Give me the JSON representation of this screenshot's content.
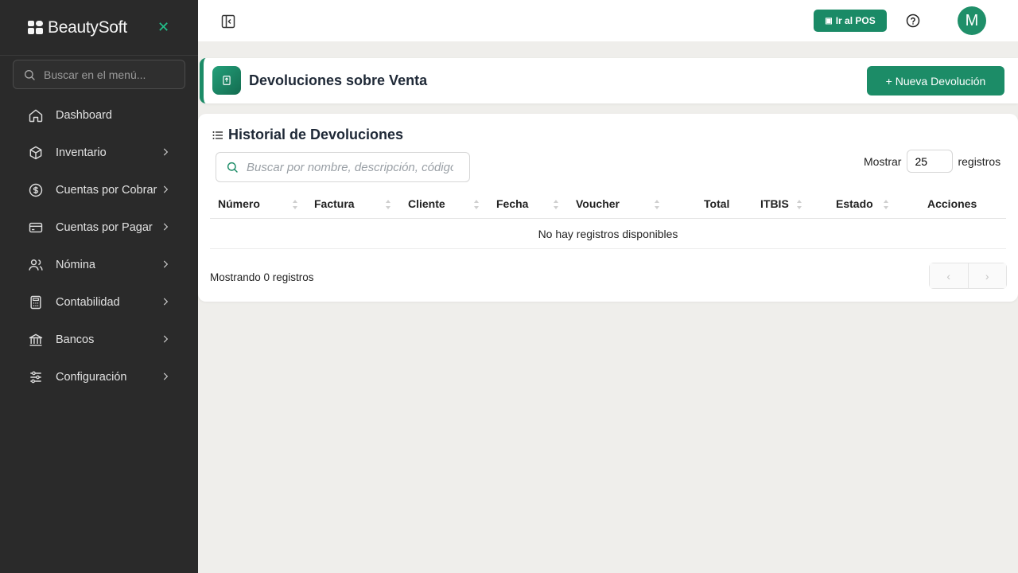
{
  "brand": {
    "name": "BeautySoft"
  },
  "sidebar": {
    "search_placeholder": "Buscar en el menú...",
    "items": [
      {
        "label": "Dashboard",
        "icon": "home-icon",
        "has_children": false
      },
      {
        "label": "Inventario",
        "icon": "box-icon",
        "has_children": true
      },
      {
        "label": "Cuentas por Cobrar",
        "icon": "dollar-circle-icon",
        "has_children": true
      },
      {
        "label": "Cuentas por Pagar",
        "icon": "credit-card-icon",
        "has_children": true
      },
      {
        "label": "Nómina",
        "icon": "users-icon",
        "has_children": true
      },
      {
        "label": "Contabilidad",
        "icon": "calculator-icon",
        "has_children": true
      },
      {
        "label": "Bancos",
        "icon": "bank-icon",
        "has_children": true
      },
      {
        "label": "Configuración",
        "icon": "sliders-icon",
        "has_children": true
      }
    ]
  },
  "topbar": {
    "pos_label": "Ir al POS",
    "avatar_initial": "M"
  },
  "page": {
    "title": "Devoluciones sobre Venta",
    "new_button": "+ Nueva Devolución"
  },
  "table": {
    "title": "Historial de Devoluciones",
    "search_placeholder": "Buscar por nombre, descripción, código...",
    "show_label": "Mostrar",
    "show_value": "25",
    "records_label": "registros",
    "columns": [
      "Número",
      "Factura",
      "Cliente",
      "Fecha",
      "Voucher",
      "Total",
      "ITBIS",
      "Estado",
      "Acciones"
    ],
    "empty_message": "No hay registros disponibles",
    "footer": "Mostrando 0 registros",
    "prev": "‹",
    "next": "›"
  },
  "colors": {
    "accent": "#1c8c67",
    "sidebar_bg": "#2a2a2a",
    "page_bg": "#efeeeb"
  }
}
